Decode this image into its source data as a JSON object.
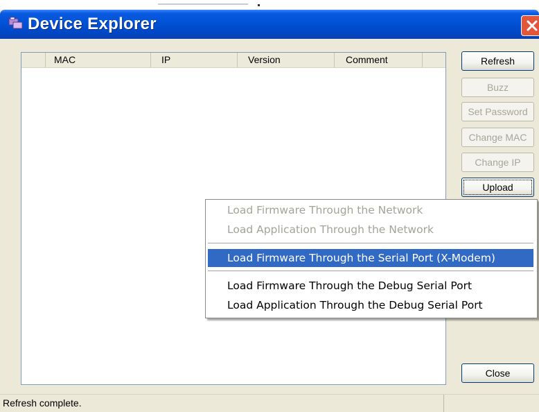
{
  "window": {
    "title": "Device Explorer"
  },
  "list": {
    "columns": [
      "MAC",
      "IP",
      "Version",
      "Comment"
    ],
    "rows": []
  },
  "buttons": {
    "refresh": "Refresh",
    "buzz": "Buzz",
    "set_password": "Set Password",
    "change_mac": "Change MAC",
    "change_ip": "Change IP",
    "upload": "Upload",
    "close": "Close"
  },
  "upload_menu": {
    "items": [
      {
        "label": "Load Firmware Through the Network",
        "enabled": false
      },
      {
        "label": "Load Application Through the Network",
        "enabled": false
      },
      {
        "label": "Load Firmware Through the Serial Port (X-Modem)",
        "enabled": true,
        "selected": true
      },
      {
        "label": "Load Firmware Through the Debug Serial Port",
        "enabled": true
      },
      {
        "label": "Load Application Through the Debug Serial Port",
        "enabled": true
      }
    ]
  },
  "status": {
    "text": "Refresh complete."
  },
  "colors": {
    "titlebar": "#0052d6",
    "menu_highlight": "#316ac5",
    "close_button": "#e2573b",
    "window_bg": "#ece9d8"
  },
  "icons": {
    "app": "device-explorer-app-icon",
    "close": "close-x-icon"
  }
}
